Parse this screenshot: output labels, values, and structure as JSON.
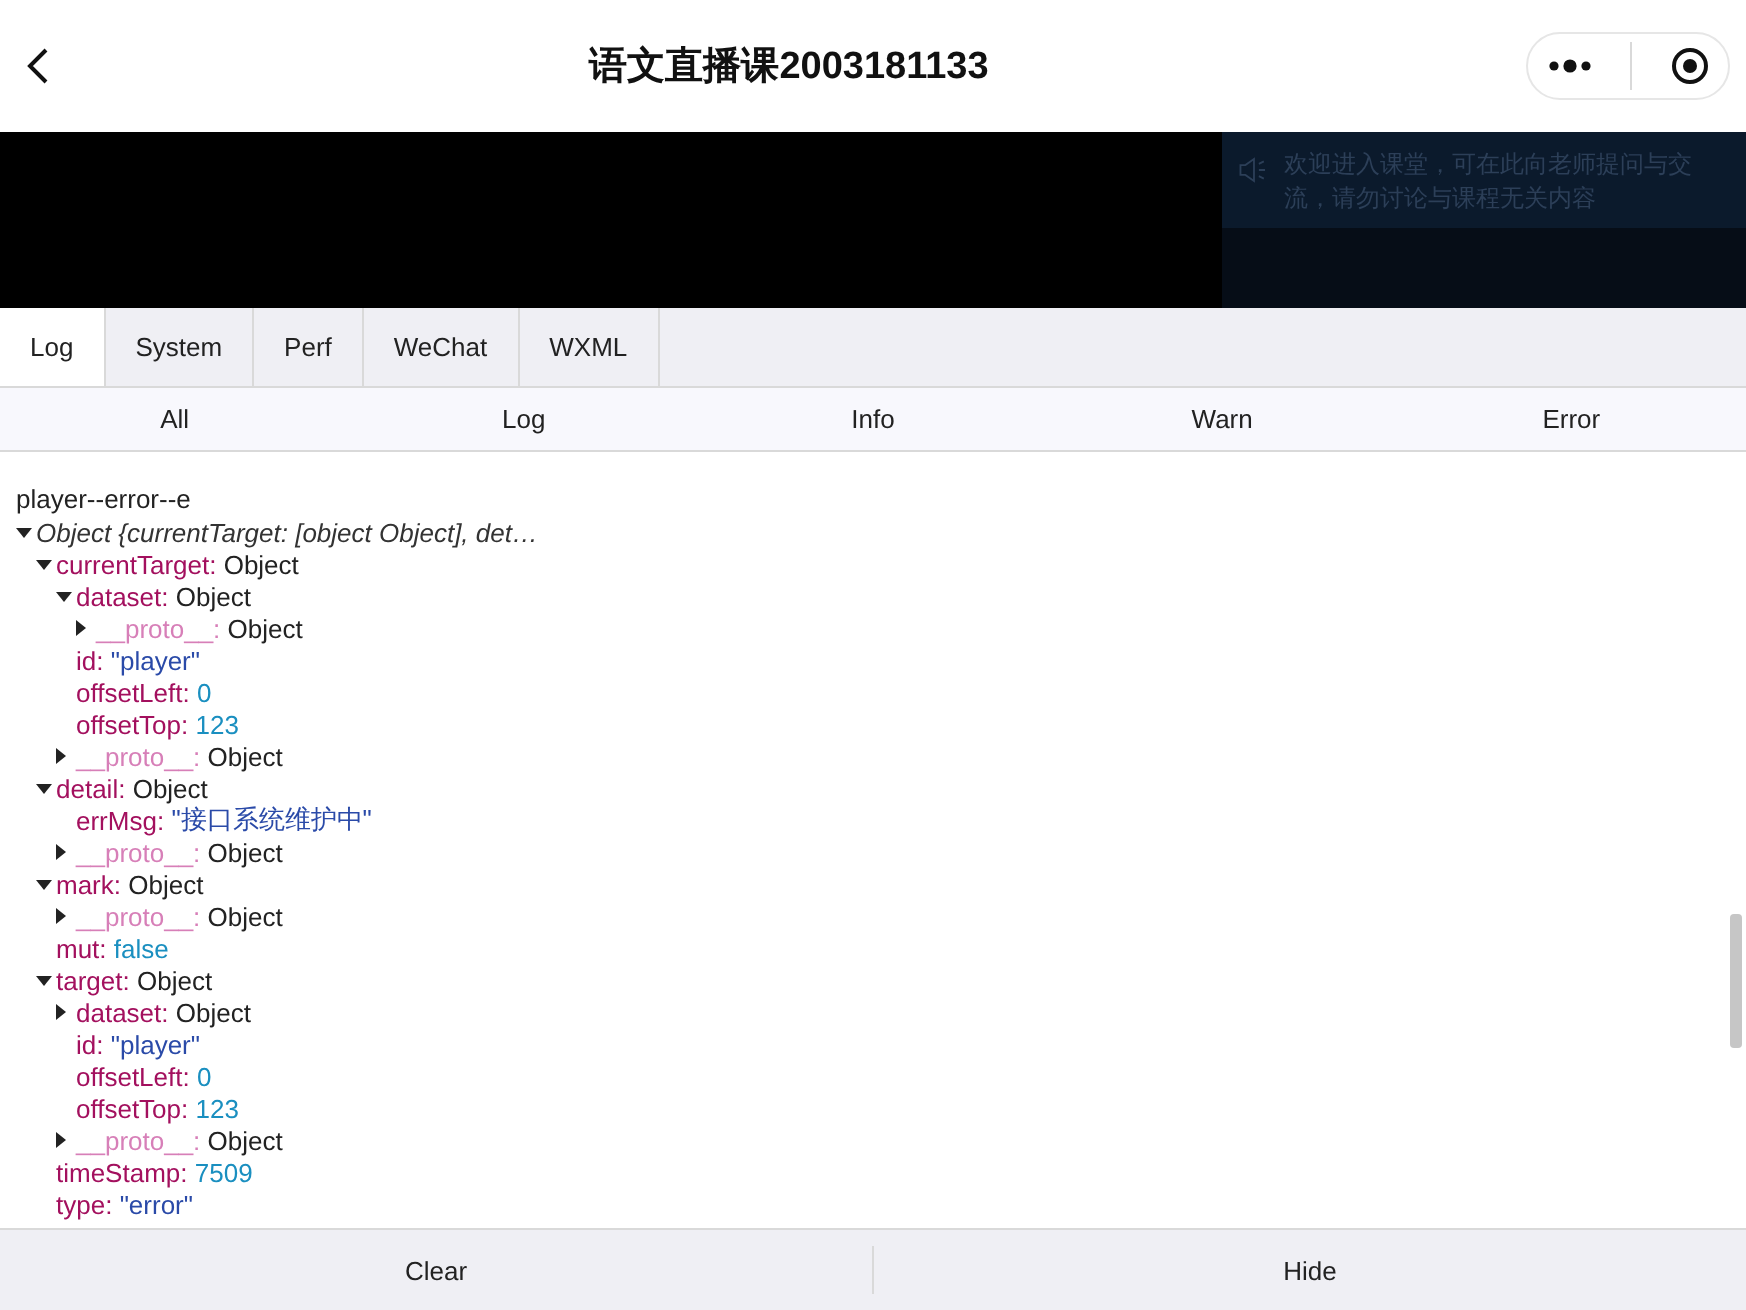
{
  "header": {
    "title": "语文直播课2003181133"
  },
  "video": {
    "notice": "欢迎进入课堂，可在此向老师提问与交流，请勿讨论与课程无关内容"
  },
  "tabs": [
    {
      "label": "Log",
      "selected": true
    },
    {
      "label": "System",
      "selected": false
    },
    {
      "label": "Perf",
      "selected": false
    },
    {
      "label": "WeChat",
      "selected": false
    },
    {
      "label": "WXML",
      "selected": false
    }
  ],
  "filters": [
    {
      "label": "All"
    },
    {
      "label": "Log"
    },
    {
      "label": "Info"
    },
    {
      "label": "Warn"
    },
    {
      "label": "Error"
    }
  ],
  "log": {
    "message": "player--error--e",
    "tree": [
      {
        "key": "Object {currentTarget: [object Object], det…",
        "kind": "summary",
        "expanded": true,
        "children": [
          {
            "key": "currentTarget:",
            "value": "Object",
            "kind": "object",
            "expanded": true,
            "children": [
              {
                "key": "dataset:",
                "value": "Object",
                "kind": "object",
                "expanded": true,
                "children": [
                  {
                    "key": "__proto__:",
                    "value": "Object",
                    "kind": "proto",
                    "expanded": false
                  }
                ]
              },
              {
                "key": "id:",
                "value": "\"player\"",
                "kind": "string"
              },
              {
                "key": "offsetLeft:",
                "value": "0",
                "kind": "number"
              },
              {
                "key": "offsetTop:",
                "value": "123",
                "kind": "number"
              },
              {
                "key": "__proto__:",
                "value": "Object",
                "kind": "proto",
                "expanded": false
              }
            ]
          },
          {
            "key": "detail:",
            "value": "Object",
            "kind": "object",
            "expanded": true,
            "children": [
              {
                "key": "errMsg:",
                "value": "\"接口系统维护中\"",
                "kind": "string"
              },
              {
                "key": "__proto__:",
                "value": "Object",
                "kind": "proto",
                "expanded": false
              }
            ]
          },
          {
            "key": "mark:",
            "value": "Object",
            "kind": "object",
            "expanded": true,
            "children": [
              {
                "key": "__proto__:",
                "value": "Object",
                "kind": "proto",
                "expanded": false
              }
            ]
          },
          {
            "key": "mut:",
            "value": "false",
            "kind": "number"
          },
          {
            "key": "target:",
            "value": "Object",
            "kind": "object",
            "expanded": true,
            "children": [
              {
                "key": "dataset:",
                "value": "Object",
                "kind": "object",
                "expanded": false
              },
              {
                "key": "id:",
                "value": "\"player\"",
                "kind": "string"
              },
              {
                "key": "offsetLeft:",
                "value": "0",
                "kind": "number"
              },
              {
                "key": "offsetTop:",
                "value": "123",
                "kind": "number"
              },
              {
                "key": "__proto__:",
                "value": "Object",
                "kind": "proto",
                "expanded": false
              }
            ]
          },
          {
            "key": "timeStamp:",
            "value": "7509",
            "kind": "number"
          },
          {
            "key": "type:",
            "value": "\"error\"",
            "kind": "string"
          }
        ]
      }
    ]
  },
  "bottom": [
    {
      "label": "Clear"
    },
    {
      "label": "Hide"
    }
  ]
}
